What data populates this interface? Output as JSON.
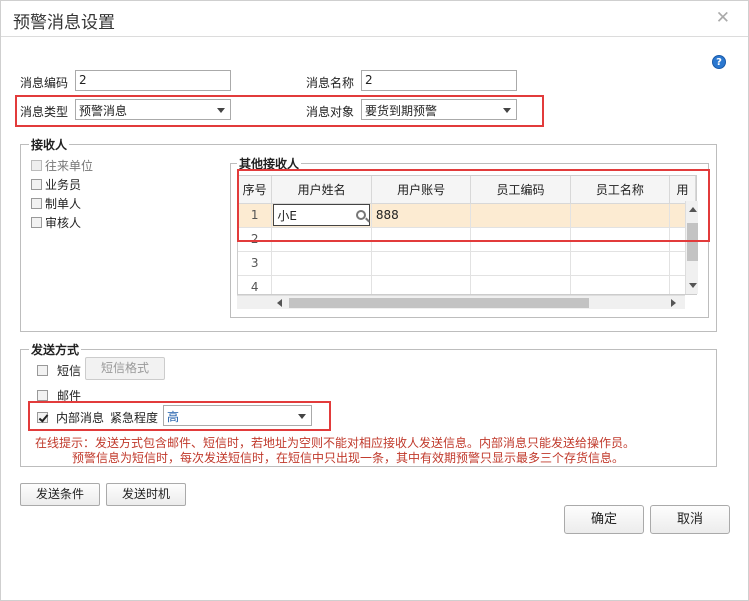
{
  "dialog": {
    "title": "预警消息设置"
  },
  "form": {
    "msg_code_label": "消息编码",
    "msg_code_value": "2",
    "msg_name_label": "消息名称",
    "msg_name_value": "2",
    "msg_type_label": "消息类型",
    "msg_type_value": "预警消息",
    "msg_target_label": "消息对象",
    "msg_target_value": "要货到期预警"
  },
  "receivers": {
    "legend": "接收人",
    "options": [
      {
        "label": "往来单位",
        "checked": false,
        "disabled": true
      },
      {
        "label": "业务员",
        "checked": false,
        "disabled": false
      },
      {
        "label": "制单人",
        "checked": false,
        "disabled": false
      },
      {
        "label": "审核人",
        "checked": false,
        "disabled": false
      }
    ],
    "other_legend": "其他接收人",
    "columns": [
      "序号",
      "用户姓名",
      "用户账号",
      "员工编码",
      "员工名称",
      "用"
    ],
    "rows": [
      {
        "no": "1",
        "user_name": "小E",
        "account": "888",
        "emp_code": "",
        "emp_name": ""
      },
      {
        "no": "2",
        "user_name": "",
        "account": "",
        "emp_code": "",
        "emp_name": ""
      },
      {
        "no": "3",
        "user_name": "",
        "account": "",
        "emp_code": "",
        "emp_name": ""
      },
      {
        "no": "4",
        "user_name": "",
        "account": "",
        "emp_code": "",
        "emp_name": ""
      }
    ]
  },
  "send_method": {
    "legend": "发送方式",
    "sms_label": "短信",
    "sms_format_button": "短信格式",
    "mail_label": "邮件",
    "internal_label": "内部消息",
    "urgency_label": "紧急程度",
    "urgency_value": "高",
    "hint_line1": "在线提示：发送方式包含邮件、短信时，若地址为空则不能对相应接收人发送信息。内部消息只能发送给操作员。",
    "hint_line2": "预警信息为短信时，每次发送短信时，在短信中只出现一条，其中有效期预警只显示最多三个存货信息。"
  },
  "buttons": {
    "send_condition": "发送条件",
    "send_timing": "发送时机",
    "ok": "确定",
    "cancel": "取消"
  },
  "colors": {
    "highlight_border": "#e23b3b",
    "selected_row": "#fcebd2",
    "hint_text": "#c0392b"
  }
}
